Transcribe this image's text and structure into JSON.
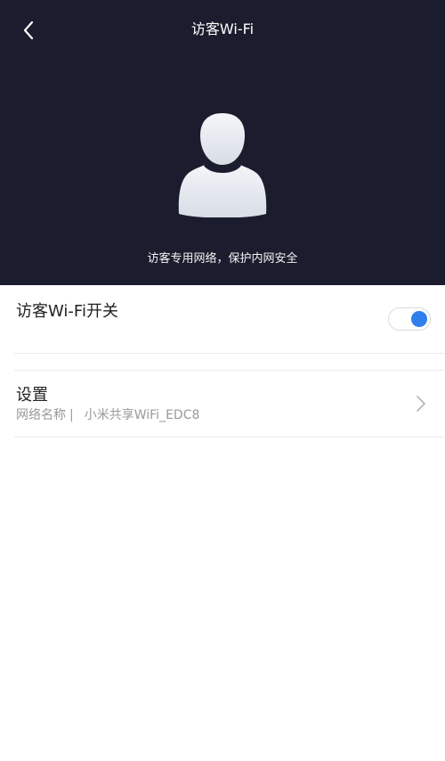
{
  "header": {
    "title": "访客Wi-Fi",
    "back_icon": "chevron-left-icon",
    "subtitle": "访客专用网络，保护内网安全",
    "background": "#1b1d2e",
    "avatar_icon": "user-silhouette-icon"
  },
  "toggle_row": {
    "label": "访客Wi-Fi开关",
    "enabled": true,
    "accent": "#2f80ed"
  },
  "settings_row": {
    "label": "设置",
    "network_label": "网络名称",
    "separator": "|",
    "network_name": "小米共享WiFi_EDC8",
    "chevron_icon": "chevron-right-icon"
  }
}
